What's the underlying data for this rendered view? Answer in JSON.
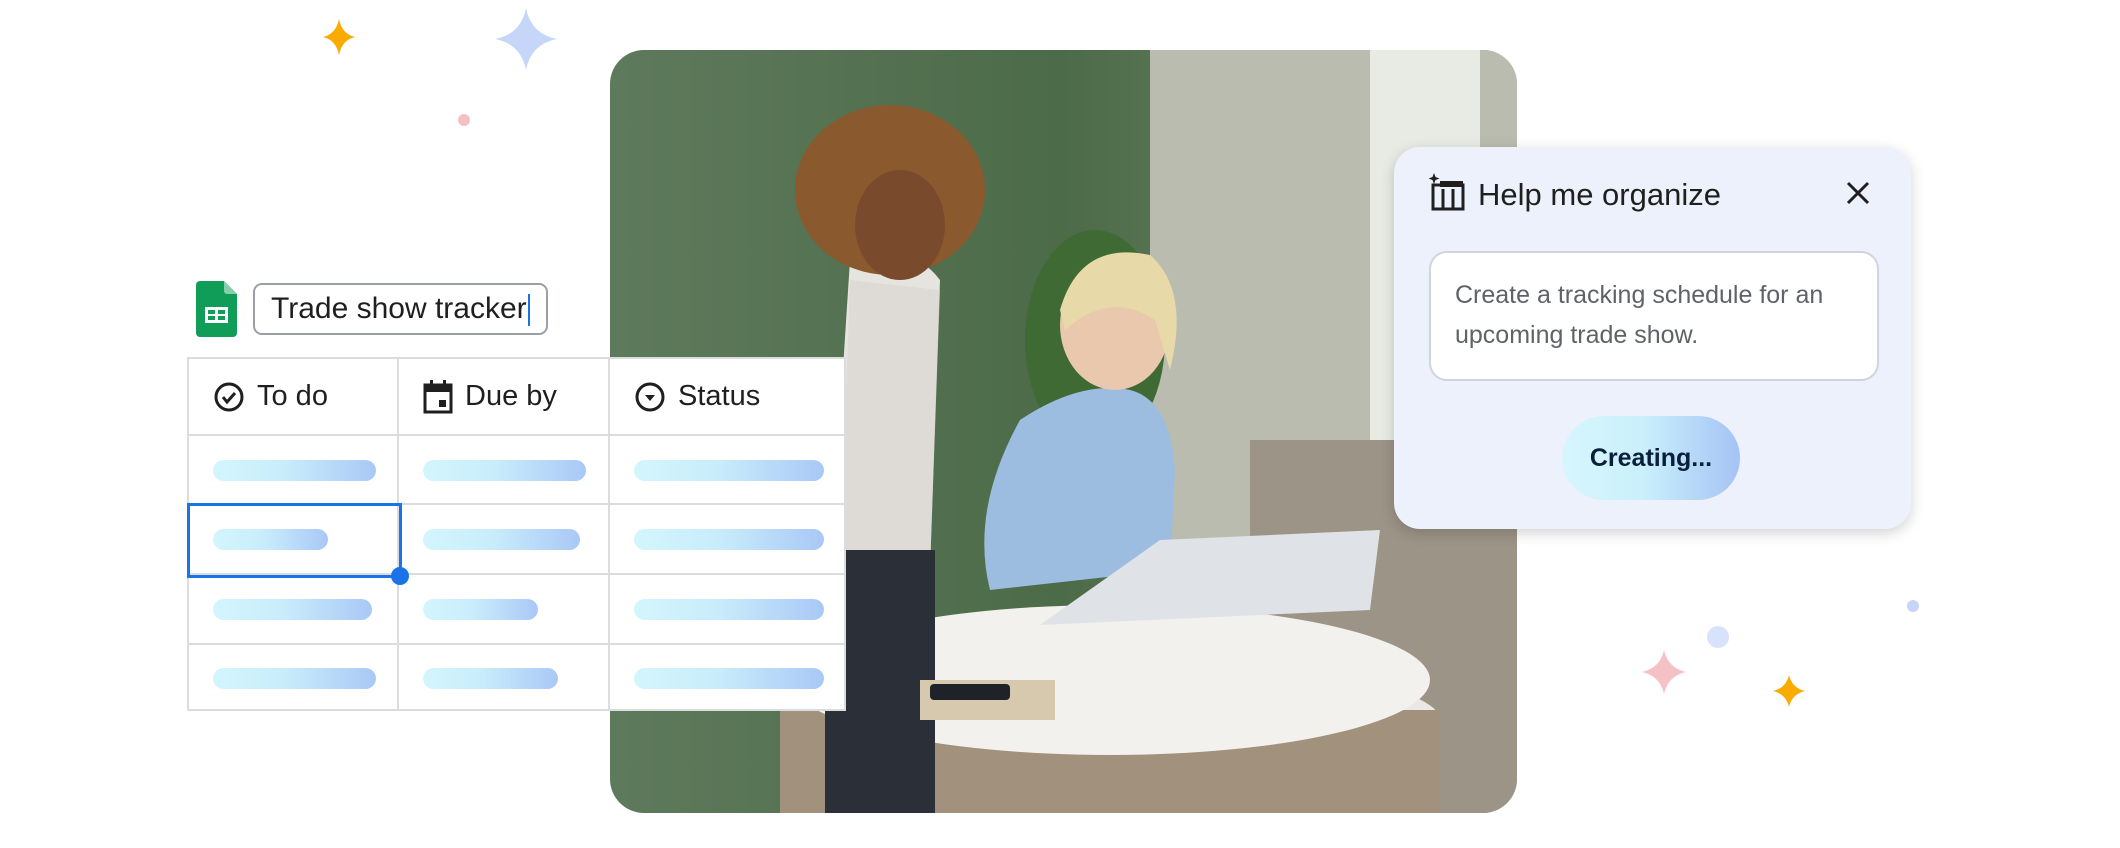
{
  "sheet": {
    "title": "Trade show tracker",
    "app_icon": "google-sheets-icon",
    "columns": [
      {
        "label": "To do",
        "icon": "check-circle-icon"
      },
      {
        "label": "Due by",
        "icon": "calendar-icon"
      },
      {
        "label": "Status",
        "icon": "dropdown-circle-icon"
      }
    ],
    "rows": 4,
    "selected_cell": "row 2, To do"
  },
  "panel": {
    "title": "Help me organize",
    "icon": "table-sparkle-icon",
    "close_icon": "close-icon",
    "prompt": "Create a tracking schedule for an upcoming trade show.",
    "button_label": "Creating..."
  },
  "colors": {
    "accent": "#1a73e8",
    "sheets_green": "#0f9d58",
    "panel_bg": "#edf1fb",
    "yellow_sparkle": "#f9ab00",
    "blue_sparkle": "#c5d6f8",
    "pink_sparkle": "#f6c1c4"
  }
}
